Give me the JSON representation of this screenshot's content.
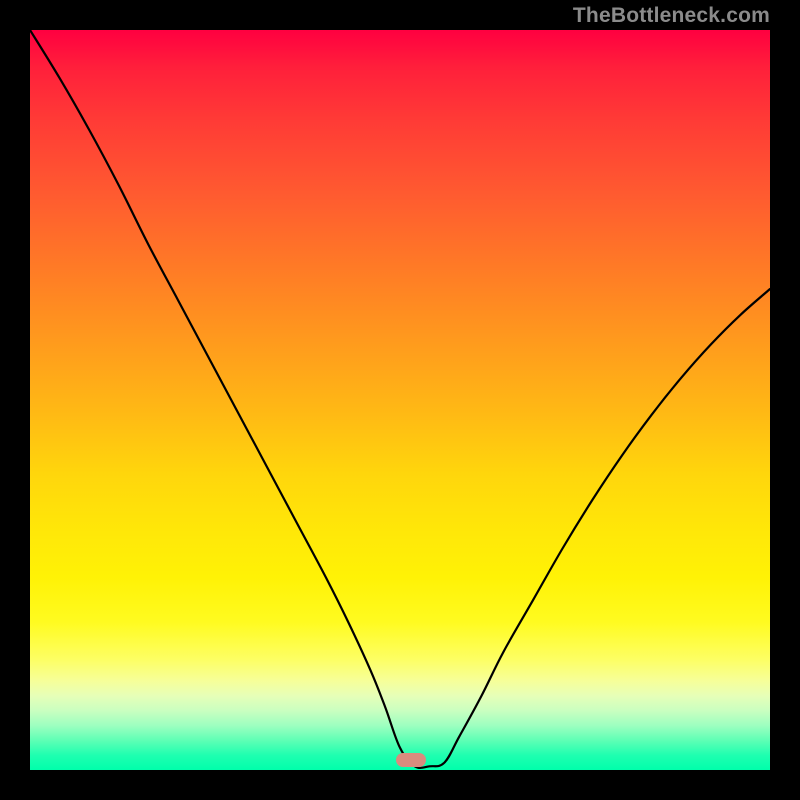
{
  "watermark": "TheBottleneck.com",
  "marker": {
    "color": "#d98c7e",
    "x_percent": 51.5,
    "bottom_percent": 0.4
  },
  "chart_data": {
    "type": "line",
    "title": "",
    "xlabel": "",
    "ylabel": "",
    "xlim": [
      0,
      100
    ],
    "ylim": [
      0,
      100
    ],
    "grid": false,
    "legend": false,
    "series": [
      {
        "name": "bottleneck-curve",
        "color": "#000000",
        "x": [
          0,
          4,
          8,
          12,
          16,
          20,
          24,
          28,
          32,
          36,
          40,
          43,
          46,
          48,
          50,
          52,
          54,
          56,
          58,
          61,
          64,
          68,
          72,
          76,
          80,
          84,
          88,
          92,
          96,
          100
        ],
        "y": [
          100,
          93.5,
          86.5,
          79,
          71,
          63.5,
          56,
          48.5,
          41,
          33.5,
          26,
          20,
          13.5,
          8.5,
          3,
          0.5,
          0.5,
          1,
          4.5,
          10,
          16,
          23,
          30,
          36.5,
          42.5,
          48,
          53,
          57.5,
          61.5,
          65
        ]
      }
    ]
  }
}
